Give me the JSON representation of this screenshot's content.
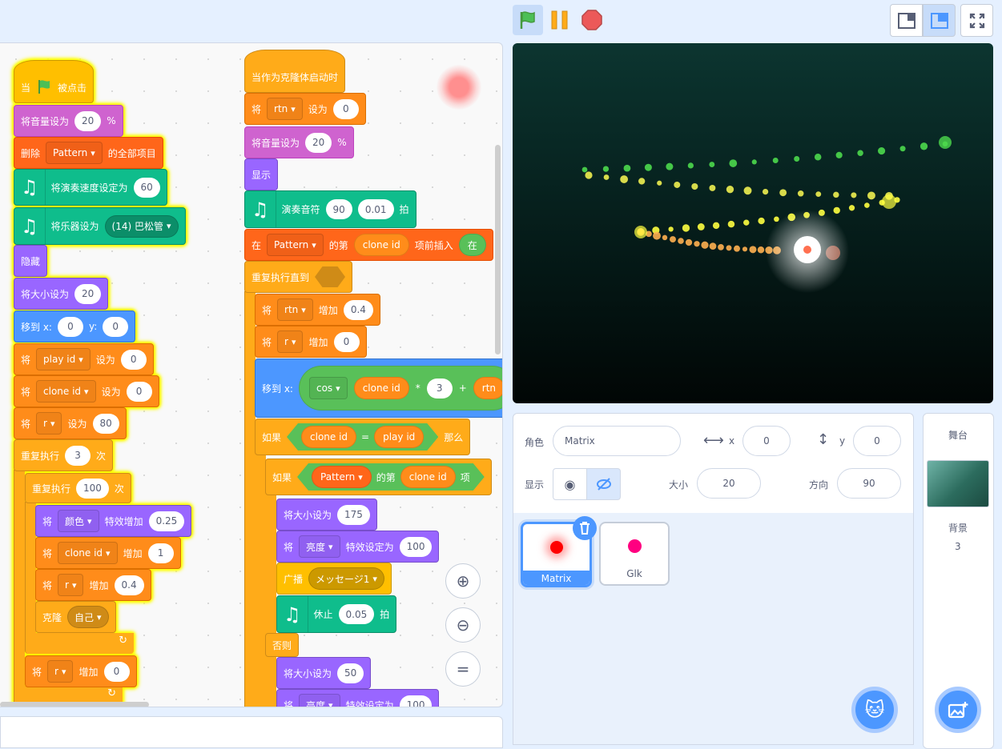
{
  "colors": {
    "events": "#ffbf00",
    "control": "#ffab19",
    "sound": "#cf63cf",
    "looks": "#9966ff",
    "motion": "#4c97ff",
    "variables": "#ff8c1a",
    "lists": "#ff661a",
    "music": "#0fbd8c",
    "operators": "#59c059",
    "accent": "#4c97ff"
  },
  "header": {
    "green_flag": "green-flag-icon",
    "pause": "pause-icon",
    "stop": "stop-icon"
  },
  "blocks": [
    {
      "cat": "events",
      "hat": true,
      "parts": [
        {
          "t": "text",
          "v": "当"
        },
        {
          "t": "flag"
        },
        {
          "t": "text",
          "v": "被点击"
        }
      ]
    },
    {
      "cat": "sound",
      "parts": [
        {
          "t": "text",
          "v": "将音量设为"
        },
        {
          "t": "num",
          "v": "20"
        },
        {
          "t": "text",
          "v": "%"
        }
      ]
    },
    {
      "cat": "lists",
      "parts": [
        {
          "t": "text",
          "v": "删除"
        },
        {
          "t": "dd",
          "v": "Pattern"
        },
        {
          "t": "text",
          "v": "的全部项目"
        }
      ]
    },
    {
      "cat": "music",
      "parts": [
        {
          "t": "music"
        },
        {
          "t": "text",
          "v": "将演奏速度设定为"
        },
        {
          "t": "num",
          "v": "60"
        }
      ]
    },
    {
      "cat": "music",
      "parts": [
        {
          "t": "music"
        },
        {
          "t": "text",
          "v": "将乐器设为"
        },
        {
          "t": "ddr",
          "v": "(14) 巴松管"
        }
      ]
    },
    {
      "cat": "looks",
      "parts": [
        {
          "t": "text",
          "v": "隐藏"
        }
      ]
    },
    {
      "cat": "looks",
      "parts": [
        {
          "t": "text",
          "v": "将大小设为"
        },
        {
          "t": "num",
          "v": "20"
        }
      ]
    },
    {
      "cat": "motion",
      "parts": [
        {
          "t": "text",
          "v": "移到 x:"
        },
        {
          "t": "num",
          "v": "0"
        },
        {
          "t": "text",
          "v": "y:"
        },
        {
          "t": "num",
          "v": "0"
        }
      ]
    },
    {
      "cat": "variables",
      "parts": [
        {
          "t": "text",
          "v": "将"
        },
        {
          "t": "dd",
          "v": "play id"
        },
        {
          "t": "text",
          "v": "设为"
        },
        {
          "t": "num",
          "v": "0"
        }
      ]
    },
    {
      "cat": "variables",
      "parts": [
        {
          "t": "text",
          "v": "将"
        },
        {
          "t": "dd",
          "v": "clone id"
        },
        {
          "t": "text",
          "v": "设为"
        },
        {
          "t": "num",
          "v": "0"
        }
      ]
    },
    {
      "cat": "variables",
      "parts": [
        {
          "t": "text",
          "v": "将"
        },
        {
          "t": "dd",
          "v": "r"
        },
        {
          "t": "text",
          "v": "设为"
        },
        {
          "t": "num",
          "v": "80"
        }
      ]
    },
    {
      "cat": "control",
      "parts": [
        {
          "t": "text",
          "v": "重复执行"
        },
        {
          "t": "num",
          "v": "3"
        },
        {
          "t": "text",
          "v": "次"
        }
      ]
    },
    {
      "cat": "control",
      "parts": [
        {
          "t": "text",
          "v": "重复执行"
        },
        {
          "t": "num",
          "v": "100"
        },
        {
          "t": "text",
          "v": "次"
        }
      ]
    },
    {
      "cat": "looks",
      "parts": [
        {
          "t": "text",
          "v": "将"
        },
        {
          "t": "dd",
          "v": "颜色"
        },
        {
          "t": "text",
          "v": "特效增加"
        },
        {
          "t": "num",
          "v": "0.25"
        }
      ]
    },
    {
      "cat": "variables",
      "parts": [
        {
          "t": "text",
          "v": "将"
        },
        {
          "t": "dd",
          "v": "clone id"
        },
        {
          "t": "text",
          "v": "增加"
        },
        {
          "t": "num",
          "v": "1"
        }
      ]
    },
    {
      "cat": "variables",
      "parts": [
        {
          "t": "text",
          "v": "将"
        },
        {
          "t": "dd",
          "v": "r"
        },
        {
          "t": "text",
          "v": "增加"
        },
        {
          "t": "num",
          "v": "0.4"
        }
      ]
    },
    {
      "cat": "control",
      "parts": [
        {
          "t": "text",
          "v": "克隆"
        },
        {
          "t": "ddr",
          "v": "自己"
        }
      ]
    },
    {
      "cat": "variables",
      "parts": [
        {
          "t": "text",
          "v": "将"
        },
        {
          "t": "dd",
          "v": "r"
        },
        {
          "t": "text",
          "v": "增加"
        },
        {
          "t": "num",
          "v": "0"
        }
      ]
    },
    {
      "cat": "control",
      "hat": true,
      "parts": [
        {
          "t": "text",
          "v": "当作为克隆体启动时"
        }
      ]
    },
    {
      "cat": "variables",
      "parts": [
        {
          "t": "text",
          "v": "将"
        },
        {
          "t": "dd",
          "v": "rtn"
        },
        {
          "t": "text",
          "v": "设为"
        },
        {
          "t": "num",
          "v": "0"
        }
      ]
    },
    {
      "cat": "sound",
      "parts": [
        {
          "t": "text",
          "v": "将音量设为"
        },
        {
          "t": "num",
          "v": "20"
        },
        {
          "t": "text",
          "v": "%"
        }
      ]
    },
    {
      "cat": "looks",
      "parts": [
        {
          "t": "text",
          "v": "显示"
        }
      ]
    },
    {
      "cat": "music",
      "parts": [
        {
          "t": "music"
        },
        {
          "t": "text",
          "v": "演奏音符"
        },
        {
          "t": "num",
          "v": "90"
        },
        {
          "t": "num",
          "v": "0.01"
        },
        {
          "t": "text",
          "v": "拍"
        }
      ]
    },
    {
      "cat": "lists",
      "parts": [
        {
          "t": "text",
          "v": "在"
        },
        {
          "t": "dd",
          "v": "Pattern"
        },
        {
          "t": "text",
          "v": "的第"
        },
        {
          "t": "rep",
          "c": "variables",
          "v": "clone id"
        },
        {
          "t": "text",
          "v": "项前插入"
        },
        {
          "t": "rep",
          "c": "operators",
          "v": "在"
        }
      ]
    },
    {
      "cat": "control",
      "parts": [
        {
          "t": "text",
          "v": "重复执行直到"
        },
        {
          "t": "hex"
        }
      ]
    },
    {
      "cat": "variables",
      "parts": [
        {
          "t": "text",
          "v": "将"
        },
        {
          "t": "dd",
          "v": "rtn"
        },
        {
          "t": "text",
          "v": "增加"
        },
        {
          "t": "num",
          "v": "0.4"
        }
      ]
    },
    {
      "cat": "variables",
      "parts": [
        {
          "t": "text",
          "v": "将"
        },
        {
          "t": "dd",
          "v": "r"
        },
        {
          "t": "text",
          "v": "增加"
        },
        {
          "t": "num",
          "v": "0"
        }
      ]
    },
    {
      "cat": "motion",
      "parts": [
        {
          "t": "text",
          "v": "移到 x:"
        },
        {
          "t": "opgroup",
          "items": [
            {
              "t": "dd",
              "v": "cos"
            },
            {
              "t": "rep",
              "c": "variables",
              "v": "clone id"
            },
            {
              "t": "text",
              "v": "*"
            },
            {
              "t": "num",
              "v": "3"
            },
            {
              "t": "text",
              "v": "+"
            },
            {
              "t": "rep",
              "c": "variables",
              "v": "rtn"
            }
          ]
        }
      ]
    },
    {
      "cat": "control",
      "parts": [
        {
          "t": "text",
          "v": "如果"
        },
        {
          "t": "bool",
          "items": [
            {
              "t": "rep",
              "c": "variables",
              "v": "clone id"
            },
            {
              "t": "text",
              "v": "="
            },
            {
              "t": "rep",
              "c": "variables",
              "v": "play id"
            }
          ]
        },
        {
          "t": "text",
          "v": "那么"
        }
      ]
    },
    {
      "cat": "control",
      "parts": [
        {
          "t": "text",
          "v": "如果"
        },
        {
          "t": "bool",
          "items": [
            {
              "t": "rep",
              "c": "lists",
              "v": "Pattern",
              "dd": true
            },
            {
              "t": "text",
              "v": "的第"
            },
            {
              "t": "rep",
              "c": "variables",
              "v": "clone id"
            },
            {
              "t": "text",
              "v": "项"
            }
          ]
        }
      ]
    },
    {
      "cat": "looks",
      "parts": [
        {
          "t": "text",
          "v": "将大小设为"
        },
        {
          "t": "num",
          "v": "175"
        }
      ]
    },
    {
      "cat": "looks",
      "parts": [
        {
          "t": "text",
          "v": "将"
        },
        {
          "t": "dd",
          "v": "亮度"
        },
        {
          "t": "text",
          "v": "特效设定为"
        },
        {
          "t": "num",
          "v": "100"
        }
      ]
    },
    {
      "cat": "events",
      "parts": [
        {
          "t": "text",
          "v": "广播"
        },
        {
          "t": "ddr",
          "v": "メッセージ1"
        }
      ]
    },
    {
      "cat": "music",
      "parts": [
        {
          "t": "music"
        },
        {
          "t": "text",
          "v": "休止"
        },
        {
          "t": "num",
          "v": "0.05"
        },
        {
          "t": "text",
          "v": "拍"
        }
      ]
    },
    {
      "cat": "control",
      "parts": [
        {
          "t": "text",
          "v": "否则"
        }
      ]
    },
    {
      "cat": "looks",
      "parts": [
        {
          "t": "text",
          "v": "将大小设为"
        },
        {
          "t": "num",
          "v": "50"
        }
      ]
    },
    {
      "cat": "looks",
      "parts": [
        {
          "t": "text",
          "v": "将"
        },
        {
          "t": "dd",
          "v": "亮度"
        },
        {
          "t": "text",
          "v": "特效设定为"
        },
        {
          "t": "num",
          "v": "100"
        }
      ]
    }
  ],
  "sprite_info": {
    "sprite_label": "角色",
    "sprite_name": "Matrix",
    "x_label": "x",
    "x": "0",
    "y_label": "y",
    "y": "0",
    "show_label": "显示",
    "size_label": "大小",
    "size": "20",
    "direction_label": "方向",
    "direction": "90",
    "visible": true
  },
  "sprites": [
    {
      "name": "Matrix",
      "selected": true,
      "color": "#ff0000"
    },
    {
      "name": "Glk",
      "selected": false,
      "color": "#ff0080"
    }
  ],
  "stage_panel": {
    "title": "舞台",
    "backdrops_label": "背景",
    "backdrops_count": "3"
  }
}
